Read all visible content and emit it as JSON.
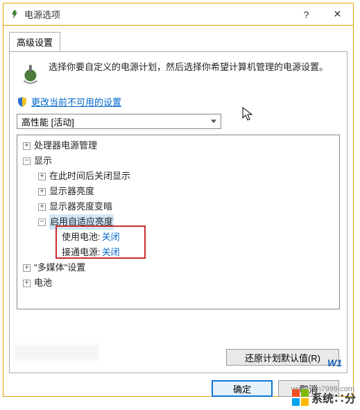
{
  "window": {
    "title": "电源选项"
  },
  "tabs": {
    "advanced": "高级设置"
  },
  "intro": "选择你要自定义的电源计划，然后选择你希望计算机管理的电源设置。",
  "uac_link": "更改当前不可用的设置",
  "plan_selected": "高性能 [活动]",
  "tree": {
    "cpu": "处理器电源管理",
    "display": "显示",
    "display_off_after": "在此时间后关闭显示",
    "display_brightness": "显示器亮度",
    "display_dimmed": "显示器亮度变暗",
    "adaptive_brightness": "启用自适应亮度",
    "on_battery_label": "使用电池:",
    "on_battery_value": "关闭",
    "plugged_in_label": "接通电源:",
    "plugged_in_value": "关闭",
    "multimedia": "\"多媒体\"设置",
    "battery": "电池"
  },
  "restore_defaults": "还原计划默认值(R)",
  "buttons": {
    "ok": "确定",
    "cancel": "取消"
  },
  "watermark": {
    "brand": "系统∷分",
    "url": "www.win7999.com",
    "wten": "W1"
  }
}
